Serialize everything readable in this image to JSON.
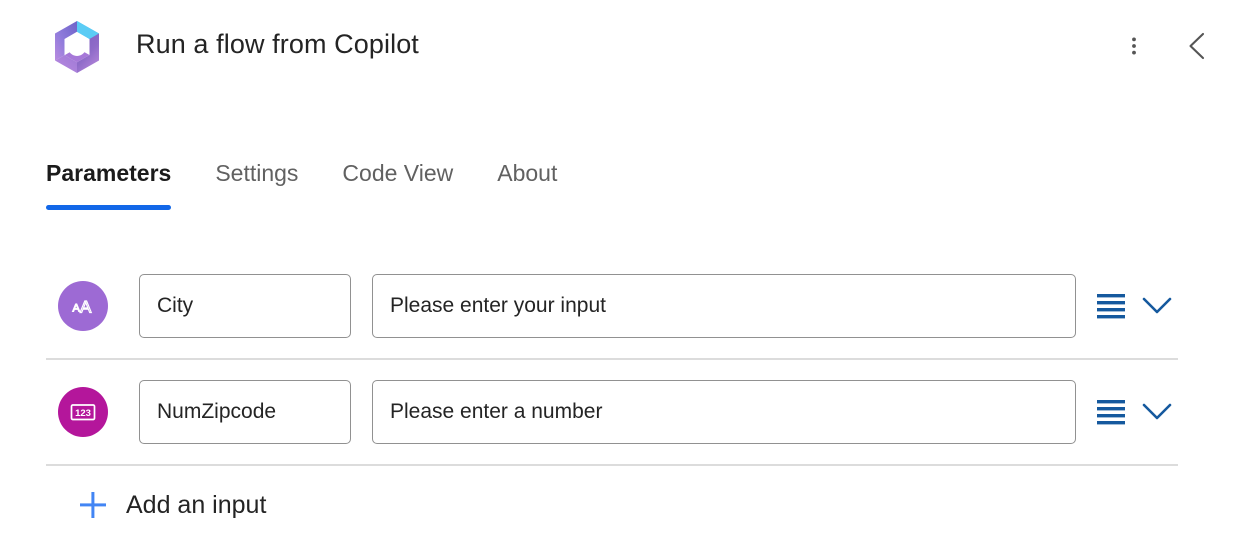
{
  "header": {
    "title": "Run a flow from Copilot",
    "logo_icon": "microsoft-copilot-logo",
    "more_icon": "more-vertical-icon",
    "back_icon": "chevron-left-icon",
    "colors": {
      "logo_purple": "#A17BE0",
      "logo_blue": "#5BC8F5",
      "logo_violet": "#7A5BC4"
    }
  },
  "tabs": [
    {
      "label": "Parameters",
      "active": true
    },
    {
      "label": "Settings",
      "active": false
    },
    {
      "label": "Code View",
      "active": false
    },
    {
      "label": "About",
      "active": false
    }
  ],
  "tab_accent_color": "#1267E8",
  "parameters": [
    {
      "icon": "text-format-icon",
      "icon_glyph": "aA",
      "icon_color": "#9D6AD4",
      "type": "text",
      "name": "City",
      "value": "",
      "placeholder": "Please enter your input",
      "menu_icon": "list-lines-icon",
      "expand_icon": "chevron-down-icon"
    },
    {
      "icon": "number-icon",
      "icon_glyph": "123",
      "icon_color": "#B4169B",
      "type": "number",
      "name": "NumZipcode",
      "value": "",
      "placeholder": "Please enter a number",
      "menu_icon": "list-lines-icon",
      "expand_icon": "chevron-down-icon"
    }
  ],
  "row_action_color": "#15599E",
  "add_input": {
    "label": "Add an input",
    "icon": "plus-icon",
    "icon_color": "#4285F4"
  }
}
